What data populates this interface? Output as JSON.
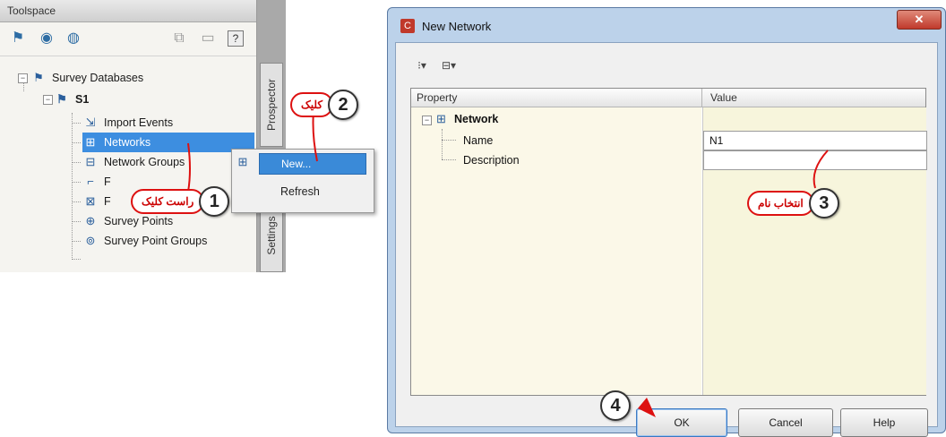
{
  "toolspace": {
    "title": "Toolspace",
    "tree": {
      "root": "Survey Databases",
      "db": "S1",
      "items": [
        {
          "label": "Import Events",
          "icon": "import-events-icon"
        },
        {
          "label": "Networks",
          "icon": "networks-icon"
        },
        {
          "label": "Network Groups",
          "icon": "network-groups-icon"
        },
        {
          "label": "F",
          "icon": "figures-icon"
        },
        {
          "label": "F",
          "icon": "figure-groups-icon"
        },
        {
          "label": "Survey Points",
          "icon": "survey-points-icon"
        },
        {
          "label": "Survey Point Groups",
          "icon": "survey-point-groups-icon"
        }
      ]
    },
    "side_tabs": [
      "Prospector",
      "Settings"
    ]
  },
  "context_menu": {
    "items": [
      "New...",
      "Refresh"
    ]
  },
  "dialog": {
    "title": "New Network",
    "close_symbol": "✕",
    "grid": {
      "header_property": "Property",
      "header_value": "Value",
      "category": "Network",
      "rows": [
        {
          "name": "Name",
          "value": "N1"
        },
        {
          "name": "Description",
          "value": ""
        }
      ]
    },
    "buttons": {
      "ok": "OK",
      "cancel": "Cancel",
      "help": "Help"
    }
  },
  "callouts": [
    {
      "num": "1",
      "text": "راست کلیک"
    },
    {
      "num": "2",
      "text": "کلیک"
    },
    {
      "num": "3",
      "text": "انتخاب نام"
    },
    {
      "num": "4",
      "text": ""
    }
  ],
  "colors": {
    "selection": "#3d8ee0",
    "callout_border": "#d11111",
    "dialog_frame": "#bcd2ea"
  }
}
